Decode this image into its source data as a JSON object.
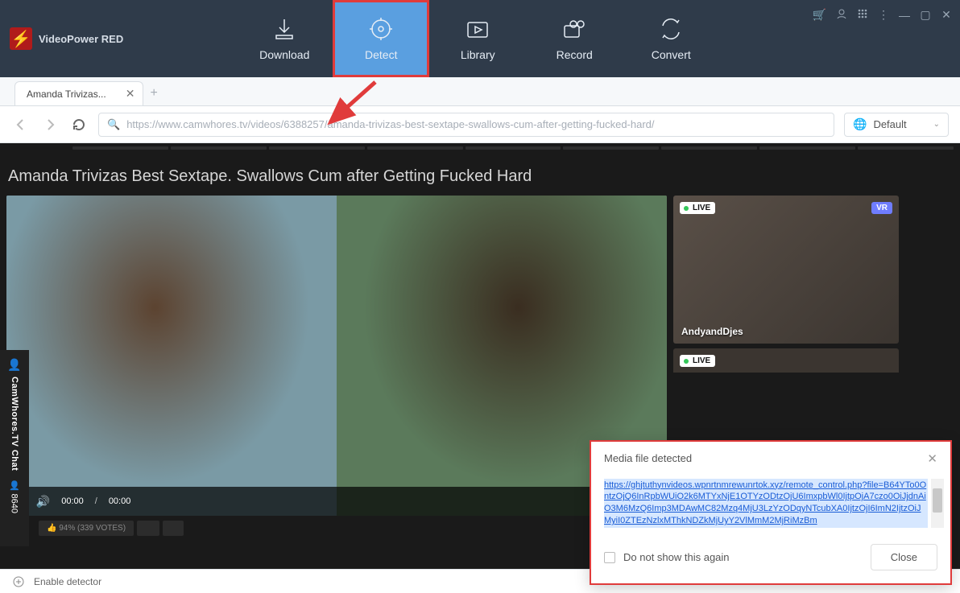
{
  "app": {
    "name": "VideoPower RED"
  },
  "nav": [
    {
      "label": "Download",
      "active": false
    },
    {
      "label": "Detect",
      "active": true
    },
    {
      "label": "Library",
      "active": false
    },
    {
      "label": "Record",
      "active": false
    },
    {
      "label": "Convert",
      "active": false
    }
  ],
  "tab": {
    "title": "Amanda Trivizas..."
  },
  "url": "https://www.camwhores.tv/videos/6388257/amanda-trivizas-best-sextape-swallows-cum-after-getting-fucked-hard/",
  "lang": "Default",
  "page_heading": "Amanda Trivizas Best Sextape. Swallows Cum after Getting Fucked Hard",
  "player": {
    "current": "00:00",
    "duration": "00:00"
  },
  "side_cards": [
    {
      "live": "LIVE",
      "vr": "VR",
      "name": "AndyandDjes"
    },
    {
      "live": "LIVE"
    }
  ],
  "chat_sidebar": {
    "label": "CamWhores.TV Chat",
    "count": "8640",
    "icon": "👤"
  },
  "votes_chip": "94% (339 VOTES)",
  "statusbar": {
    "label": "Enable detector"
  },
  "popup": {
    "title": "Media file detected",
    "url": "https://ghjtuthynvideos.wpnrtnmrewunrtok.xyz/remote_control.php?file=B64YTo0OntzOjQ6InRpbWUiO2k6MTYxNjE1OTYzODtzOjU6ImxpbWl0IjtpOjA7czo0OiJjdnAiO3M6MzQ6Imp3MDAwMC82Mzq4MjU3LzYzODqyNTcubXA0IjtzOjI6ImN2IjtzOiJMyiI0ZTEzNzlxMThkNDZkMjUyY2VlMmM2MjRiMzBm",
    "checkbox": "Do not show this again",
    "close_btn": "Close"
  }
}
